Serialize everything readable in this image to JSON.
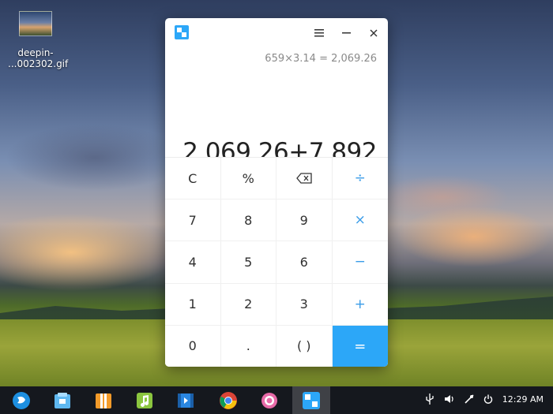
{
  "desktop": {
    "icon_label_line1": "deepin-",
    "icon_label_line2": "...002302.gif"
  },
  "calculator": {
    "history": "659×3.14 = 2,069.26",
    "expression": "2,069.26+7,892",
    "keys": [
      {
        "label": "C",
        "type": "fn"
      },
      {
        "label": "%",
        "type": "fn"
      },
      {
        "label": "",
        "type": "backspace"
      },
      {
        "label": "÷",
        "type": "op"
      },
      {
        "label": "7",
        "type": "num"
      },
      {
        "label": "8",
        "type": "num"
      },
      {
        "label": "9",
        "type": "num"
      },
      {
        "label": "×",
        "type": "op"
      },
      {
        "label": "4",
        "type": "num"
      },
      {
        "label": "5",
        "type": "num"
      },
      {
        "label": "6",
        "type": "num"
      },
      {
        "label": "−",
        "type": "op"
      },
      {
        "label": "1",
        "type": "num"
      },
      {
        "label": "2",
        "type": "num"
      },
      {
        "label": "3",
        "type": "num"
      },
      {
        "label": "+",
        "type": "op"
      },
      {
        "label": "0",
        "type": "num"
      },
      {
        "label": ".",
        "type": "num"
      },
      {
        "label": "( )",
        "type": "num"
      },
      {
        "label": "=",
        "type": "eq"
      }
    ],
    "colors": {
      "accent": "#2ca7f8",
      "operator": "#3a9ce8"
    }
  },
  "taskbar": {
    "apps": [
      "launcher-icon",
      "app-store-icon",
      "archive-manager-icon",
      "music-icon",
      "video-icon",
      "browser-icon",
      "settings-icon",
      "calculator-icon"
    ],
    "clock": "12:29 AM"
  }
}
